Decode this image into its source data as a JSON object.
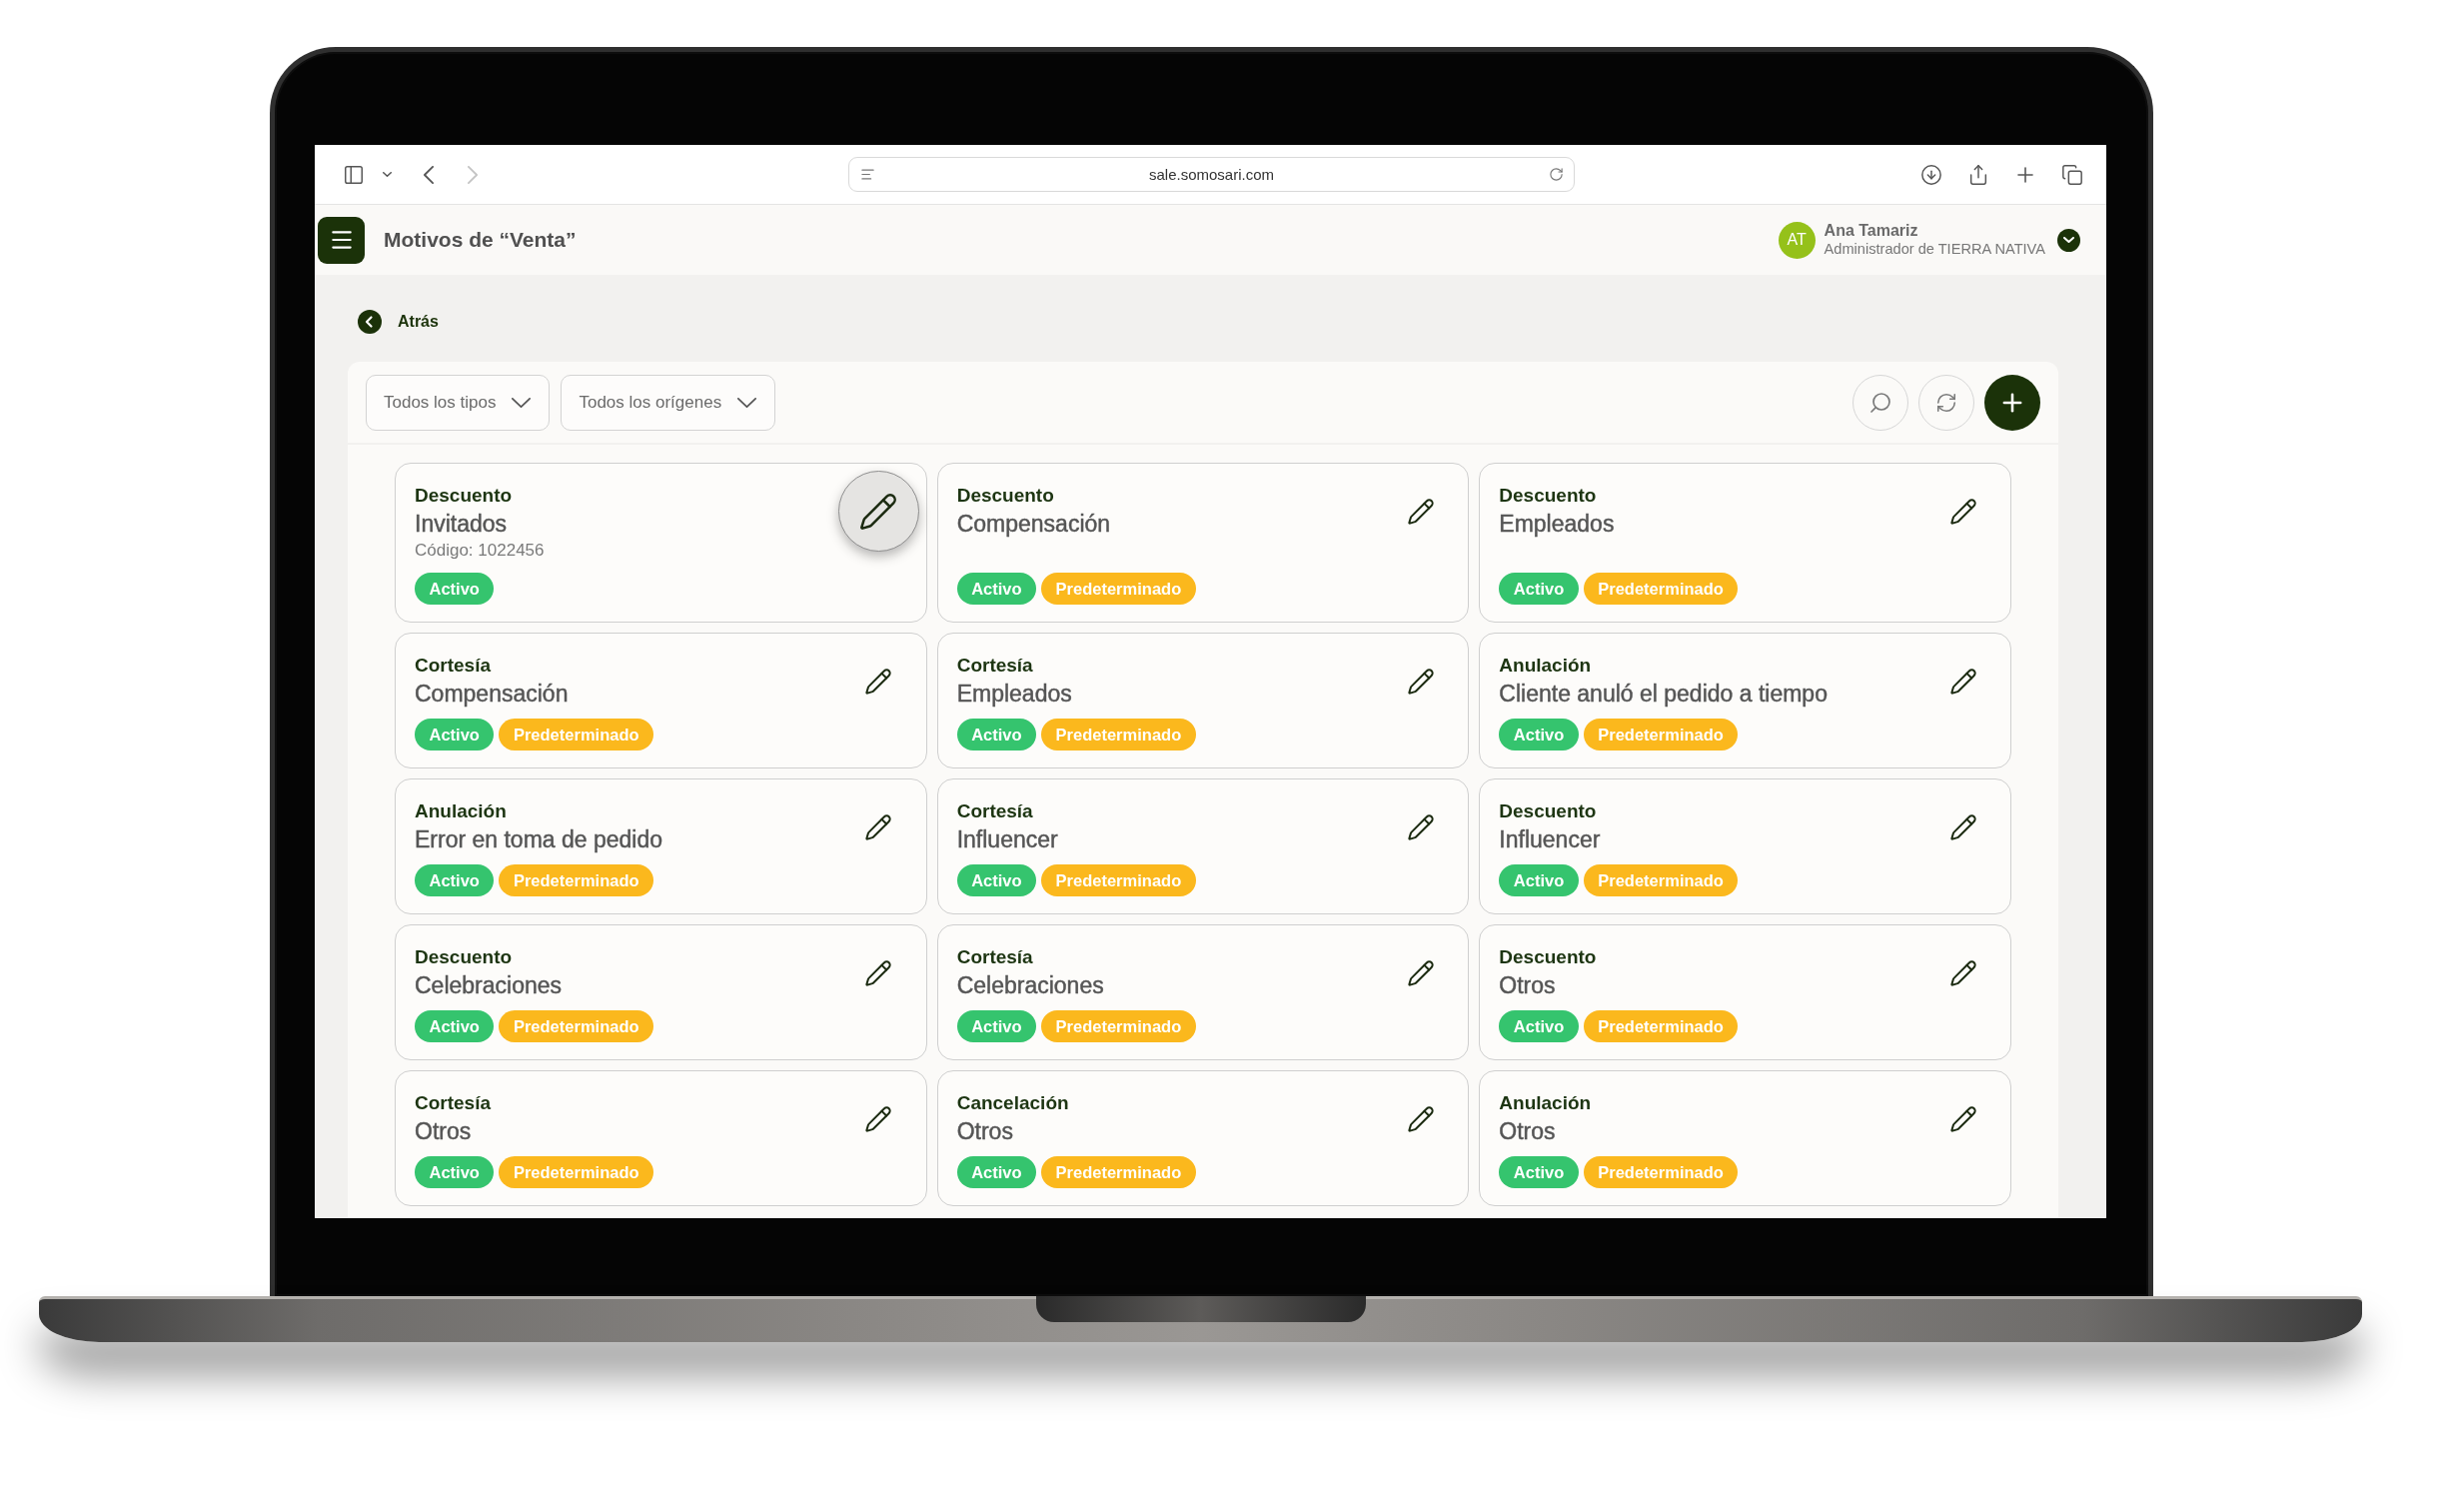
{
  "browser": {
    "url": "sale.somosari.com",
    "forward_disabled": true
  },
  "header": {
    "title": "Motivos de “Venta”",
    "user": {
      "initials": "AT",
      "name": "Ana Tamariz",
      "role": "Administrador de TIERRA NATIVA"
    }
  },
  "back_link": {
    "label": "Atrás"
  },
  "filters": [
    {
      "label": "Todos los tipos"
    },
    {
      "label": "Todos los orígenes"
    }
  ],
  "cards": [
    {
      "type": "Descuento",
      "name": "Invitados",
      "code": "Código: 1022456",
      "badges": [
        {
          "label": "Activo",
          "kind": "status"
        }
      ],
      "edit_hovered": true
    },
    {
      "type": "Descuento",
      "name": "Compensación",
      "badges": [
        {
          "label": "Activo",
          "kind": "status"
        },
        {
          "label": "Predeterminado",
          "kind": "default"
        }
      ],
      "edit_hovered": false
    },
    {
      "type": "Descuento",
      "name": "Empleados",
      "badges": [
        {
          "label": "Activo",
          "kind": "status"
        },
        {
          "label": "Predeterminado",
          "kind": "default"
        }
      ],
      "edit_hovered": false
    },
    {
      "type": "Cortesía",
      "name": "Compensación",
      "badges": [
        {
          "label": "Activo",
          "kind": "status"
        },
        {
          "label": "Predeterminado",
          "kind": "default"
        }
      ],
      "edit_hovered": false
    },
    {
      "type": "Cortesía",
      "name": "Empleados",
      "badges": [
        {
          "label": "Activo",
          "kind": "status"
        },
        {
          "label": "Predeterminado",
          "kind": "default"
        }
      ],
      "edit_hovered": false
    },
    {
      "type": "Anulación",
      "name": "Cliente anuló el pedido a tiempo",
      "badges": [
        {
          "label": "Activo",
          "kind": "status"
        },
        {
          "label": "Predeterminado",
          "kind": "default"
        }
      ],
      "edit_hovered": false
    },
    {
      "type": "Anulación",
      "name": "Error en toma de pedido",
      "badges": [
        {
          "label": "Activo",
          "kind": "status"
        },
        {
          "label": "Predeterminado",
          "kind": "default"
        }
      ],
      "edit_hovered": false
    },
    {
      "type": "Cortesía",
      "name": "Influencer",
      "badges": [
        {
          "label": "Activo",
          "kind": "status"
        },
        {
          "label": "Predeterminado",
          "kind": "default"
        }
      ],
      "edit_hovered": false
    },
    {
      "type": "Descuento",
      "name": "Influencer",
      "badges": [
        {
          "label": "Activo",
          "kind": "status"
        },
        {
          "label": "Predeterminado",
          "kind": "default"
        }
      ],
      "edit_hovered": false
    },
    {
      "type": "Descuento",
      "name": "Celebraciones",
      "badges": [
        {
          "label": "Activo",
          "kind": "status"
        },
        {
          "label": "Predeterminado",
          "kind": "default"
        }
      ],
      "edit_hovered": false
    },
    {
      "type": "Cortesía",
      "name": "Celebraciones",
      "badges": [
        {
          "label": "Activo",
          "kind": "status"
        },
        {
          "label": "Predeterminado",
          "kind": "default"
        }
      ],
      "edit_hovered": false
    },
    {
      "type": "Descuento",
      "name": "Otros",
      "badges": [
        {
          "label": "Activo",
          "kind": "status"
        },
        {
          "label": "Predeterminado",
          "kind": "default"
        }
      ],
      "edit_hovered": false
    },
    {
      "type": "Cortesía",
      "name": "Otros",
      "badges": [
        {
          "label": "Activo",
          "kind": "status"
        },
        {
          "label": "Predeterminado",
          "kind": "default"
        }
      ],
      "edit_hovered": false
    },
    {
      "type": "Cancelación",
      "name": "Otros",
      "badges": [
        {
          "label": "Activo",
          "kind": "status"
        },
        {
          "label": "Predeterminado",
          "kind": "default"
        }
      ],
      "edit_hovered": false
    },
    {
      "type": "Anulación",
      "name": "Otros",
      "badges": [
        {
          "label": "Activo",
          "kind": "status"
        },
        {
          "label": "Predeterminado",
          "kind": "default"
        }
      ],
      "edit_hovered": false
    }
  ]
}
